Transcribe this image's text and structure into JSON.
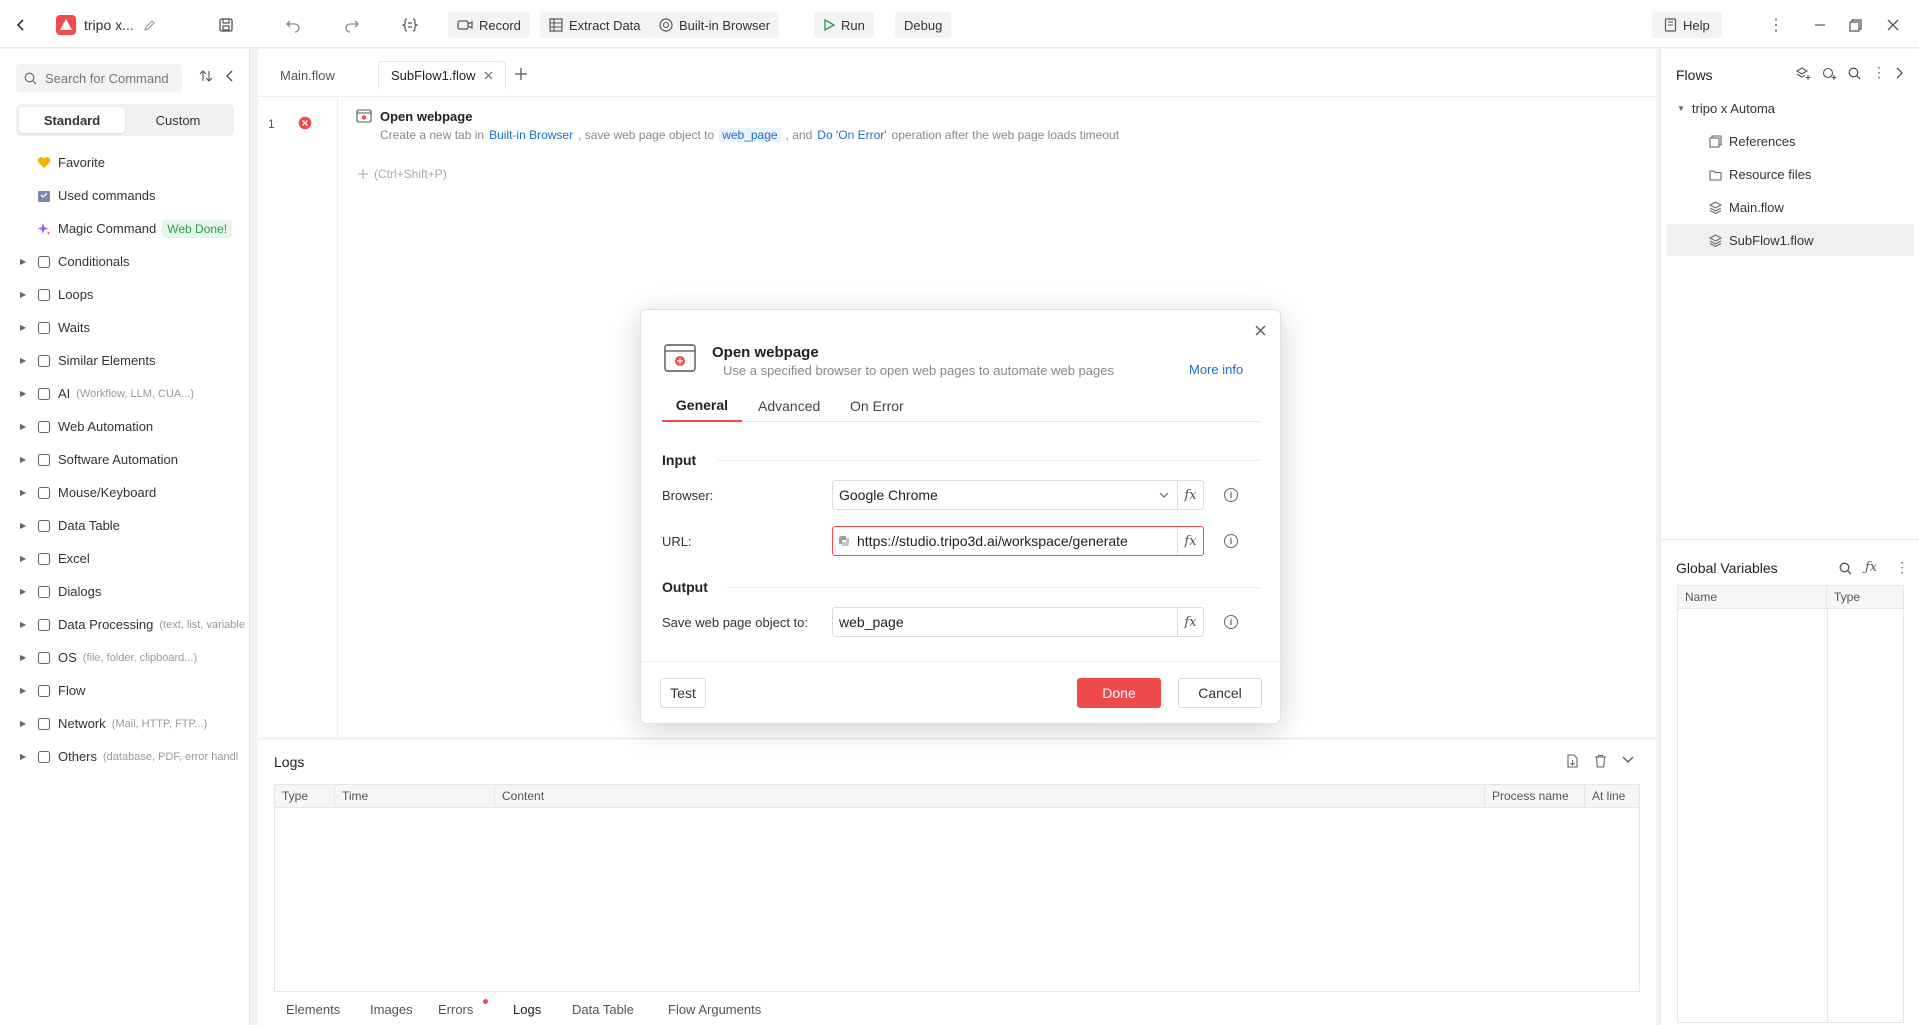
{
  "app": {
    "title": "tripo x...",
    "colors": {
      "accent": "#f04a4a",
      "link": "#1a6fd1",
      "green": "#2a9d45"
    }
  },
  "toolbar": {
    "record": "Record",
    "extract": "Extract Data",
    "browser": "Built-in Browser",
    "run": "Run",
    "debug": "Debug",
    "help": "Help"
  },
  "sidebar": {
    "search_placeholder": "Search for Command",
    "tabs": [
      "Standard",
      "Custom"
    ],
    "items": [
      {
        "label": "Favorite",
        "icon": "heart-icon",
        "arrow": false
      },
      {
        "label": "Used commands",
        "icon": "calendar-icon",
        "arrow": false
      },
      {
        "label": "Magic Command",
        "icon": "sparkle-icon",
        "arrow": false,
        "badge": "Web Done!"
      },
      {
        "label": "Conditionals",
        "icon": "branch-icon",
        "arrow": true
      },
      {
        "label": "Loops",
        "icon": "loop-icon",
        "arrow": true
      },
      {
        "label": "Waits",
        "icon": "hourglass-icon",
        "arrow": true
      },
      {
        "label": "Similar Elements",
        "icon": "similar-icon",
        "arrow": true
      },
      {
        "label": "AI",
        "hint": "(Workflow, LLM, CUA...)",
        "icon": "ai-icon",
        "arrow": true
      },
      {
        "label": "Web Automation",
        "icon": "globe-icon",
        "arrow": true
      },
      {
        "label": "Software Automation",
        "icon": "monitor-icon",
        "arrow": true
      },
      {
        "label": "Mouse/Keyboard",
        "icon": "cursor-icon",
        "arrow": true
      },
      {
        "label": "Data Table",
        "icon": "table-icon",
        "arrow": true
      },
      {
        "label": "Excel",
        "icon": "excel-icon",
        "arrow": true
      },
      {
        "label": "Dialogs",
        "icon": "dialog-icon",
        "arrow": true
      },
      {
        "label": "Data Processing",
        "hint": "(text, list, variable",
        "icon": "data-icon",
        "arrow": true
      },
      {
        "label": "OS",
        "hint": "(file, folder, clipboard...)",
        "icon": "os-icon",
        "arrow": true
      },
      {
        "label": "Flow",
        "icon": "layers-icon",
        "arrow": true
      },
      {
        "label": "Network",
        "hint": "(Mail, HTTP, FTP...)",
        "icon": "network-icon",
        "arrow": true
      },
      {
        "label": "Others",
        "hint": "(database, PDF, error handl",
        "icon": "grid-icon",
        "arrow": true
      }
    ]
  },
  "editor": {
    "tabs": [
      "Main.flow",
      "SubFlow1.flow"
    ],
    "step": {
      "number": "1",
      "title": "Open webpage",
      "desc_prefix": "Create a new tab  in",
      "desc_browser": "Built-in Browser",
      "desc_mid": ", save web page object to",
      "desc_var": "web_page",
      "desc_and": ", and",
      "desc_error": "Do 'On Error'",
      "desc_suffix": "operation after the web page loads timeout"
    },
    "add_hint": "(Ctrl+Shift+P)"
  },
  "flows": {
    "title": "Flows",
    "project": "tripo x Automa",
    "items": [
      "References",
      "Resource files",
      "Main.flow",
      "SubFlow1.flow"
    ]
  },
  "globals": {
    "title": "Global Variables",
    "cols": [
      "Name",
      "Type"
    ]
  },
  "logs": {
    "title": "Logs",
    "cols": [
      "Type",
      "Time",
      "Content",
      "Process name",
      "At line"
    ],
    "bottom_tabs": [
      "Elements",
      "Images",
      "Errors",
      "Logs",
      "Data Table",
      "Flow Arguments"
    ]
  },
  "dialog": {
    "title": "Open webpage",
    "subtitle": "Use a specified browser to open web pages to automate web pages",
    "more_info": "More info",
    "tabs": [
      "General",
      "Advanced",
      "On Error"
    ],
    "input_section": "Input",
    "browser_label": "Browser:",
    "browser_value": "Google Chrome",
    "url_label": "URL:",
    "url_value": "https://studio.tripo3d.ai/workspace/generate",
    "output_section": "Output",
    "save_label": "Save web page object to:",
    "save_value": "web_page",
    "fx": "fx",
    "test": "Test",
    "done": "Done",
    "cancel": "Cancel"
  }
}
